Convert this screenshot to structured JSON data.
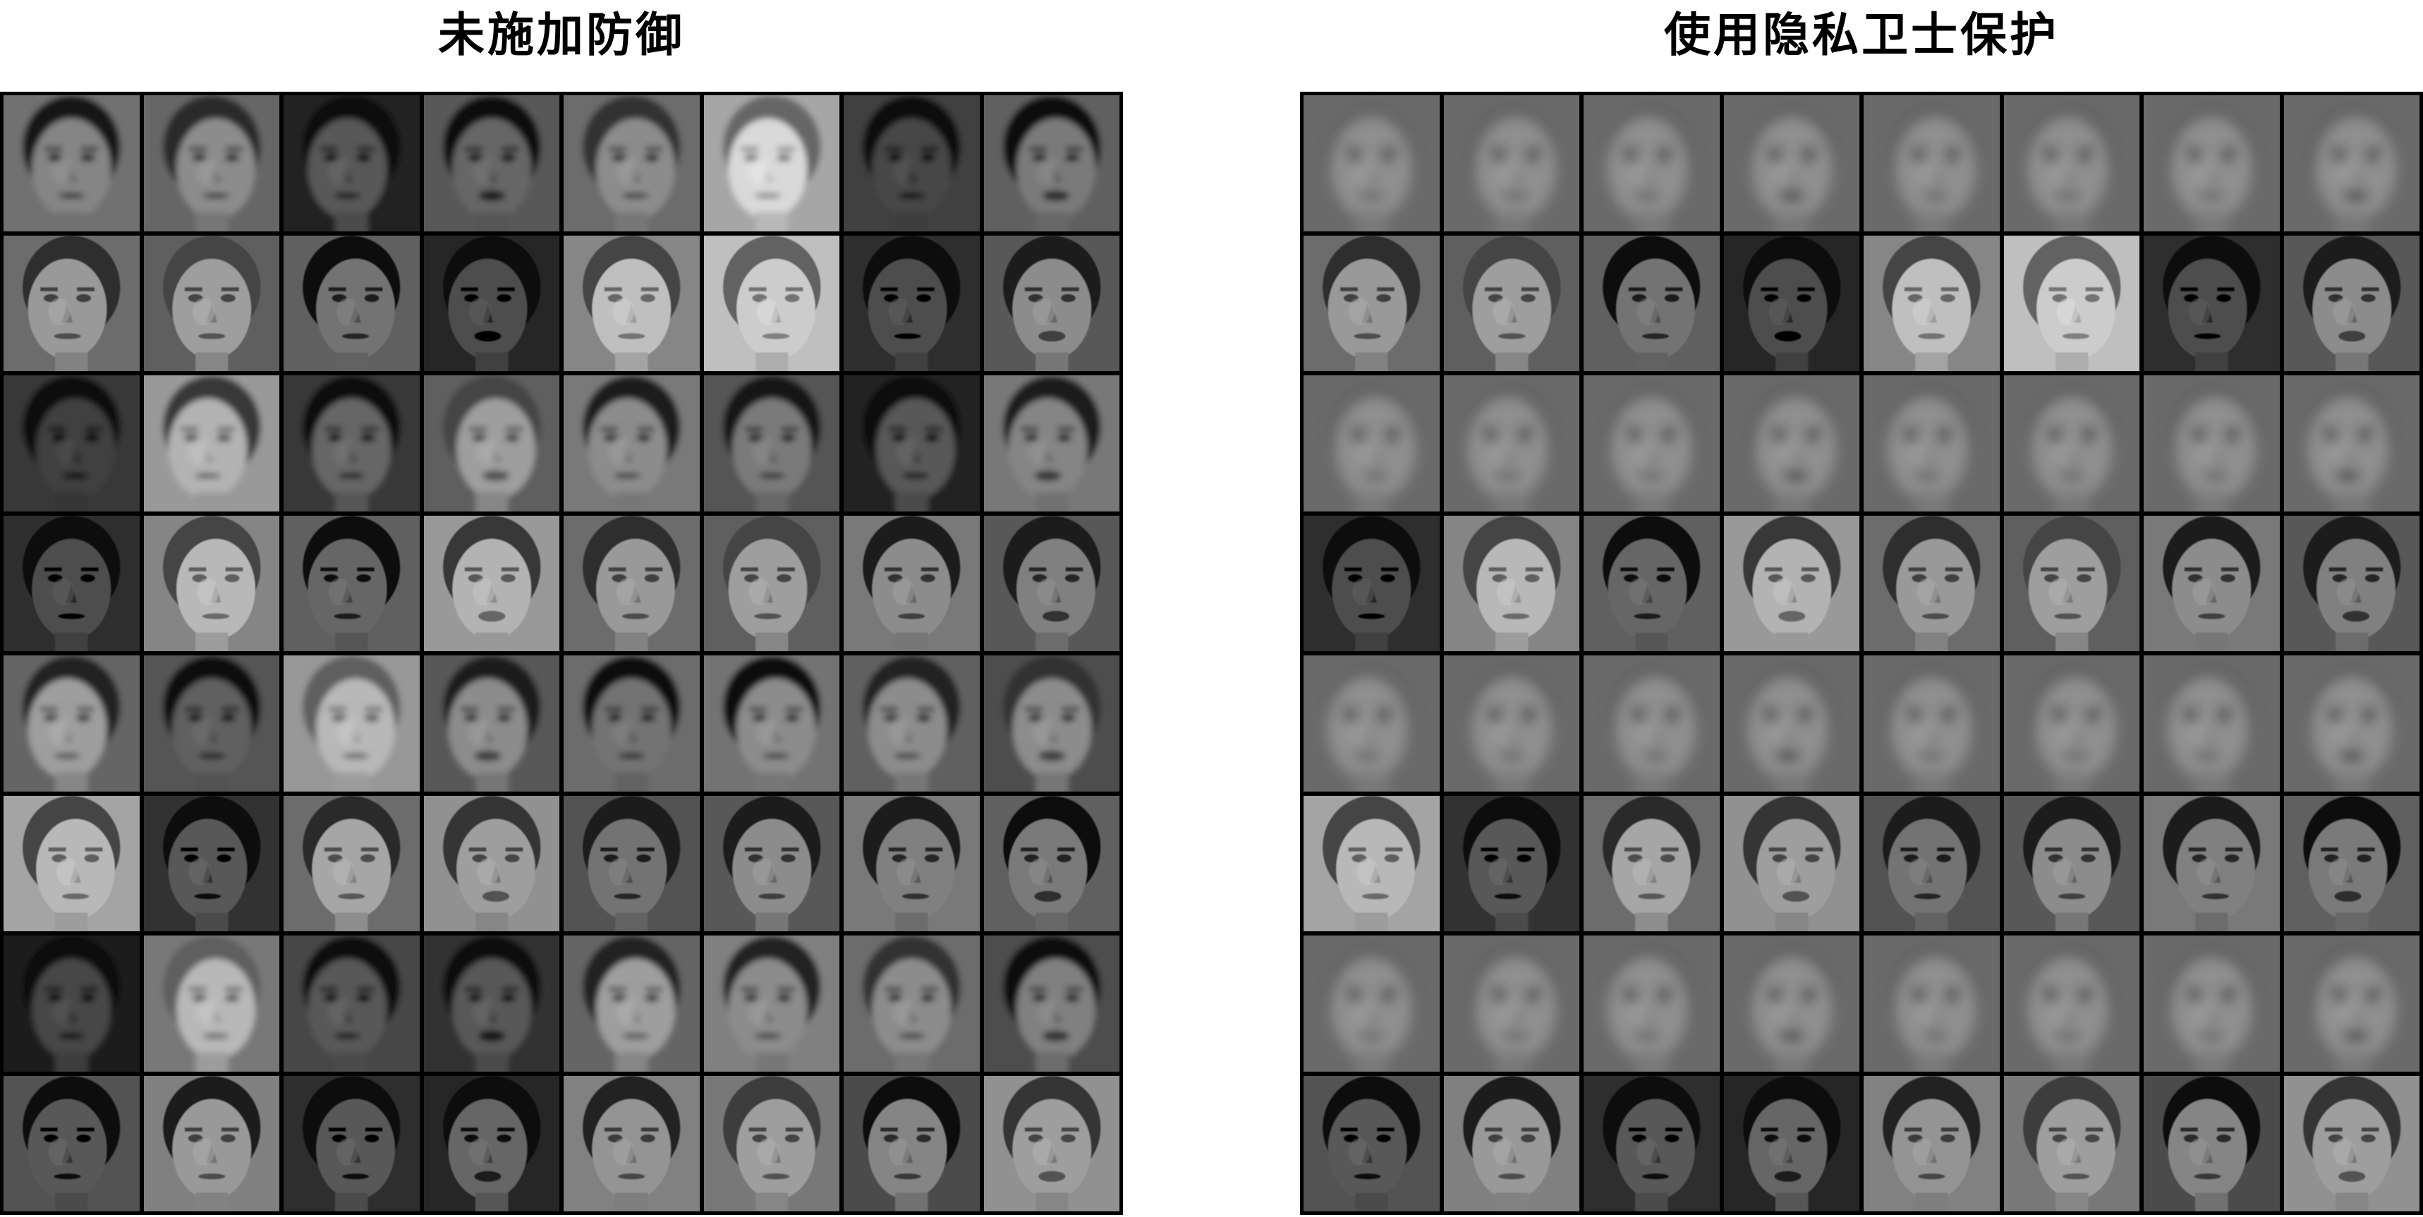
{
  "panels": [
    {
      "title": "未施加防御",
      "rows": [
        {
          "kind": "recon-noisy",
          "tones": [
            0.52,
            0.55,
            0.35,
            0.4,
            0.55,
            0.85,
            0.28,
            0.48
          ]
        },
        {
          "kind": "original",
          "tones": [
            0.6,
            0.62,
            0.45,
            0.3,
            0.75,
            0.8,
            0.3,
            0.55
          ]
        },
        {
          "kind": "recon-noisy",
          "tones": [
            0.25,
            0.7,
            0.4,
            0.62,
            0.55,
            0.48,
            0.35,
            0.52
          ]
        },
        {
          "kind": "original",
          "tones": [
            0.3,
            0.72,
            0.4,
            0.7,
            0.6,
            0.62,
            0.55,
            0.5
          ]
        },
        {
          "kind": "recon-noisy",
          "tones": [
            0.62,
            0.38,
            0.72,
            0.55,
            0.45,
            0.55,
            0.55,
            0.55
          ]
        },
        {
          "kind": "original",
          "tones": [
            0.72,
            0.35,
            0.65,
            0.62,
            0.45,
            0.55,
            0.5,
            0.48
          ]
        },
        {
          "kind": "recon-noisy",
          "tones": [
            0.28,
            0.72,
            0.35,
            0.35,
            0.62,
            0.55,
            0.55,
            0.5
          ]
        },
        {
          "kind": "original",
          "tones": [
            0.35,
            0.6,
            0.35,
            0.4,
            0.58,
            0.62,
            0.52,
            0.62
          ]
        }
      ]
    },
    {
      "title": "使用隐私卫士保护",
      "rows": [
        {
          "kind": "blur-avg",
          "tones": [
            0.52,
            0.52,
            0.52,
            0.52,
            0.52,
            0.52,
            0.52,
            0.52
          ]
        },
        {
          "kind": "original",
          "tones": [
            0.6,
            0.62,
            0.45,
            0.3,
            0.75,
            0.8,
            0.3,
            0.55
          ]
        },
        {
          "kind": "blur-avg",
          "tones": [
            0.52,
            0.52,
            0.52,
            0.52,
            0.52,
            0.52,
            0.52,
            0.52
          ]
        },
        {
          "kind": "original",
          "tones": [
            0.3,
            0.72,
            0.4,
            0.7,
            0.6,
            0.62,
            0.55,
            0.5
          ]
        },
        {
          "kind": "blur-avg",
          "tones": [
            0.52,
            0.52,
            0.52,
            0.52,
            0.52,
            0.52,
            0.52,
            0.52
          ]
        },
        {
          "kind": "original",
          "tones": [
            0.72,
            0.35,
            0.65,
            0.62,
            0.45,
            0.55,
            0.5,
            0.48
          ]
        },
        {
          "kind": "blur-avg",
          "tones": [
            0.52,
            0.52,
            0.52,
            0.52,
            0.52,
            0.52,
            0.52,
            0.52
          ]
        },
        {
          "kind": "original",
          "tones": [
            0.35,
            0.6,
            0.35,
            0.4,
            0.58,
            0.62,
            0.52,
            0.62
          ]
        }
      ]
    }
  ]
}
